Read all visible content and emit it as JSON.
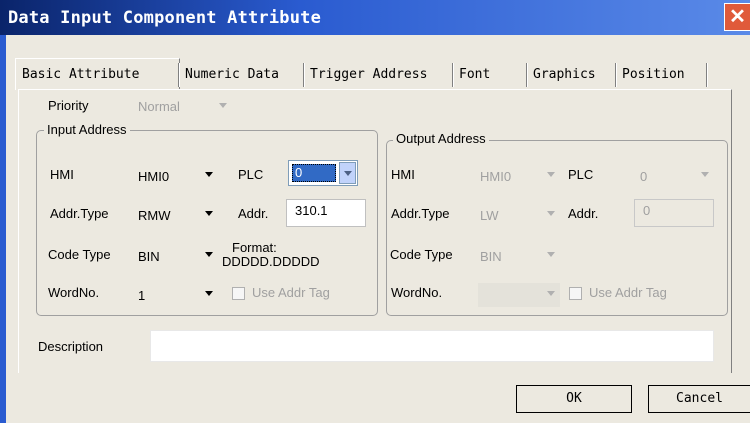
{
  "window": {
    "title": "Data Input Component Attribute",
    "close": "✕"
  },
  "tabs": [
    "Basic Attribute",
    "Numeric Data",
    "Trigger Address",
    "Font",
    "Graphics",
    "Position"
  ],
  "priority": {
    "label": "Priority",
    "value": "Normal"
  },
  "input": {
    "title": "Input Address",
    "hmi_label": "HMI",
    "hmi_value": "HMI0",
    "plc_label": "PLC",
    "plc_value": "0",
    "addrtype_label": "Addr.Type",
    "addrtype_value": "RMW",
    "addr_label": "Addr.",
    "addr_value": "310.1",
    "codetype_label": "Code Type",
    "codetype_value": "BIN",
    "format_label": "Format:",
    "format_value": "DDDDD.DDDDD",
    "wordno_label": "WordNo.",
    "wordno_value": "1",
    "use_tag_label": "Use Addr Tag"
  },
  "output": {
    "title": "Output Address",
    "hmi_label": "HMI",
    "hmi_value": "HMI0",
    "plc_label": "PLC",
    "plc_value": "0",
    "addrtype_label": "Addr.Type",
    "addrtype_value": "LW",
    "addr_label": "Addr.",
    "addr_value": "0",
    "codetype_label": "Code Type",
    "codetype_value": "BIN",
    "wordno_label": "WordNo.",
    "wordno_value": "",
    "use_tag_label": "Use Addr Tag"
  },
  "description": {
    "label": "Description",
    "value": ""
  },
  "buttons": {
    "ok": "OK",
    "cancel": "Cancel"
  }
}
